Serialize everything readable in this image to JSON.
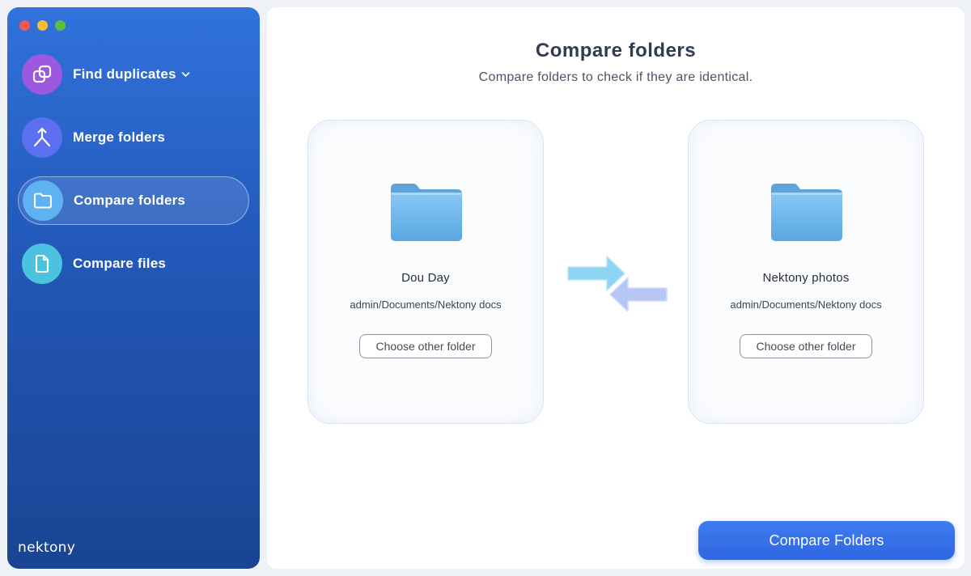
{
  "window": {
    "traffic_lights": [
      "close",
      "minimize",
      "zoom"
    ]
  },
  "sidebar": {
    "items": [
      {
        "label": "Find duplicates",
        "icon": "find-duplicates-icon",
        "has_dropdown": true,
        "active": false,
        "icon_color": "#9b59e0"
      },
      {
        "label": "Merge folders",
        "icon": "merge-icon",
        "has_dropdown": false,
        "active": false,
        "icon_color": "#5b6ff0"
      },
      {
        "label": "Compare folders",
        "icon": "folder-icon",
        "has_dropdown": false,
        "active": true,
        "icon_color": "#5fb2f1"
      },
      {
        "label": "Compare files",
        "icon": "file-icon",
        "has_dropdown": false,
        "active": false,
        "icon_color": "#4cc3de"
      }
    ],
    "brand": "nektony"
  },
  "main": {
    "title": "Compare folders",
    "subtitle": "Compare folders to check if they are identical.",
    "left_folder": {
      "name": "Dou Day",
      "path": "admin/Documents/Nektony docs",
      "button_label": "Choose other folder"
    },
    "right_folder": {
      "name": "Nektony photos",
      "path": "admin/Documents/Nektony docs",
      "button_label": "Choose other folder"
    },
    "compare_button_label": "Compare Folders"
  },
  "colors": {
    "sidebar_top": "#3172dc",
    "sidebar_bottom": "#1a4493",
    "accent": "#2f66e2",
    "folder": "#6cb6ec"
  }
}
